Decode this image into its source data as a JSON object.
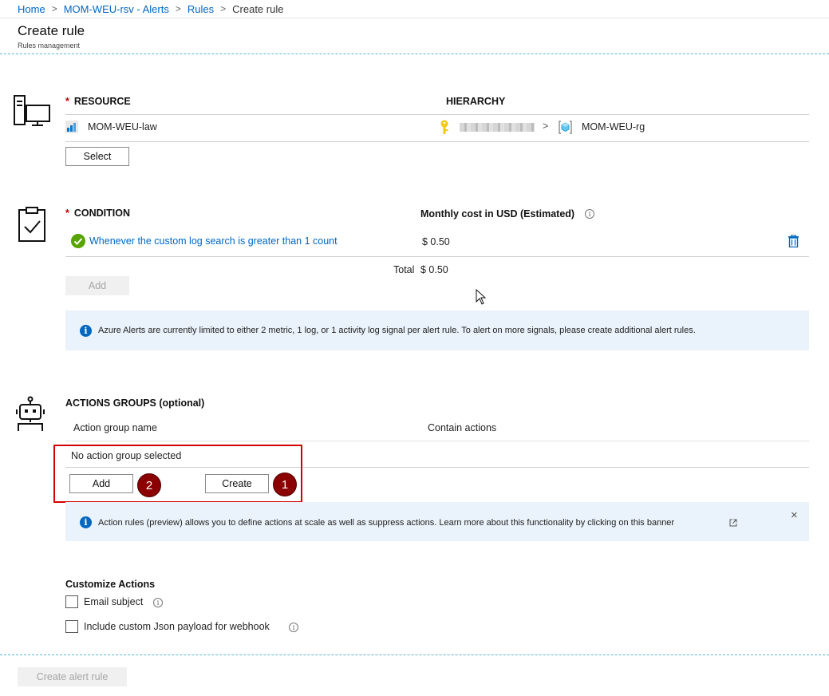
{
  "breadcrumb": {
    "items": [
      "Home",
      "MOM-WEU-rsv - Alerts",
      "Rules"
    ],
    "current": "Create rule",
    "separator": ">"
  },
  "header": {
    "title": "Create rule",
    "subtitle": "Rules management"
  },
  "resource": {
    "label": "RESOURCE",
    "required_mark": "*",
    "hierarchy_label": "HIERARCHY",
    "name": "MOM-WEU-law",
    "hierarchy_separator": ">",
    "resource_group": "MOM-WEU-rg",
    "select_button": "Select"
  },
  "condition": {
    "label": "CONDITION",
    "required_mark": "*",
    "cost_label": "Monthly cost in USD (Estimated)",
    "rule_text": "Whenever the custom log search is greater than 1 count",
    "rule_cost": "$ 0.50",
    "total_label": "Total",
    "total_value": "$ 0.50",
    "add_button": "Add",
    "info_text": "Azure Alerts are currently limited to either 2 metric, 1 log, or 1 activity log signal per alert rule. To alert on more signals, please create additional alert rules."
  },
  "actions": {
    "label": "ACTIONS GROUPS (optional)",
    "col_name": "Action group name",
    "col_actions": "Contain actions",
    "empty_text": "No action group selected",
    "add_button": "Add",
    "create_button": "Create",
    "badge_add": "2",
    "badge_create": "1",
    "banner_text": "Action rules (preview) allows you to define actions at scale as well as suppress actions. Learn more about this functionality by clicking on this banner",
    "banner_close": "×"
  },
  "customize": {
    "label": "Customize Actions",
    "options": [
      "Email subject",
      "Include custom Json payload for webhook"
    ]
  },
  "footer": {
    "create_button": "Create alert rule"
  },
  "colors": {
    "link": "#0066c4",
    "required": "#c00000",
    "success": "#57a300",
    "info": "#0067c0",
    "badge": "#8b0000",
    "highlight": "#d40000",
    "banner_bg": "#eaf2fb"
  }
}
